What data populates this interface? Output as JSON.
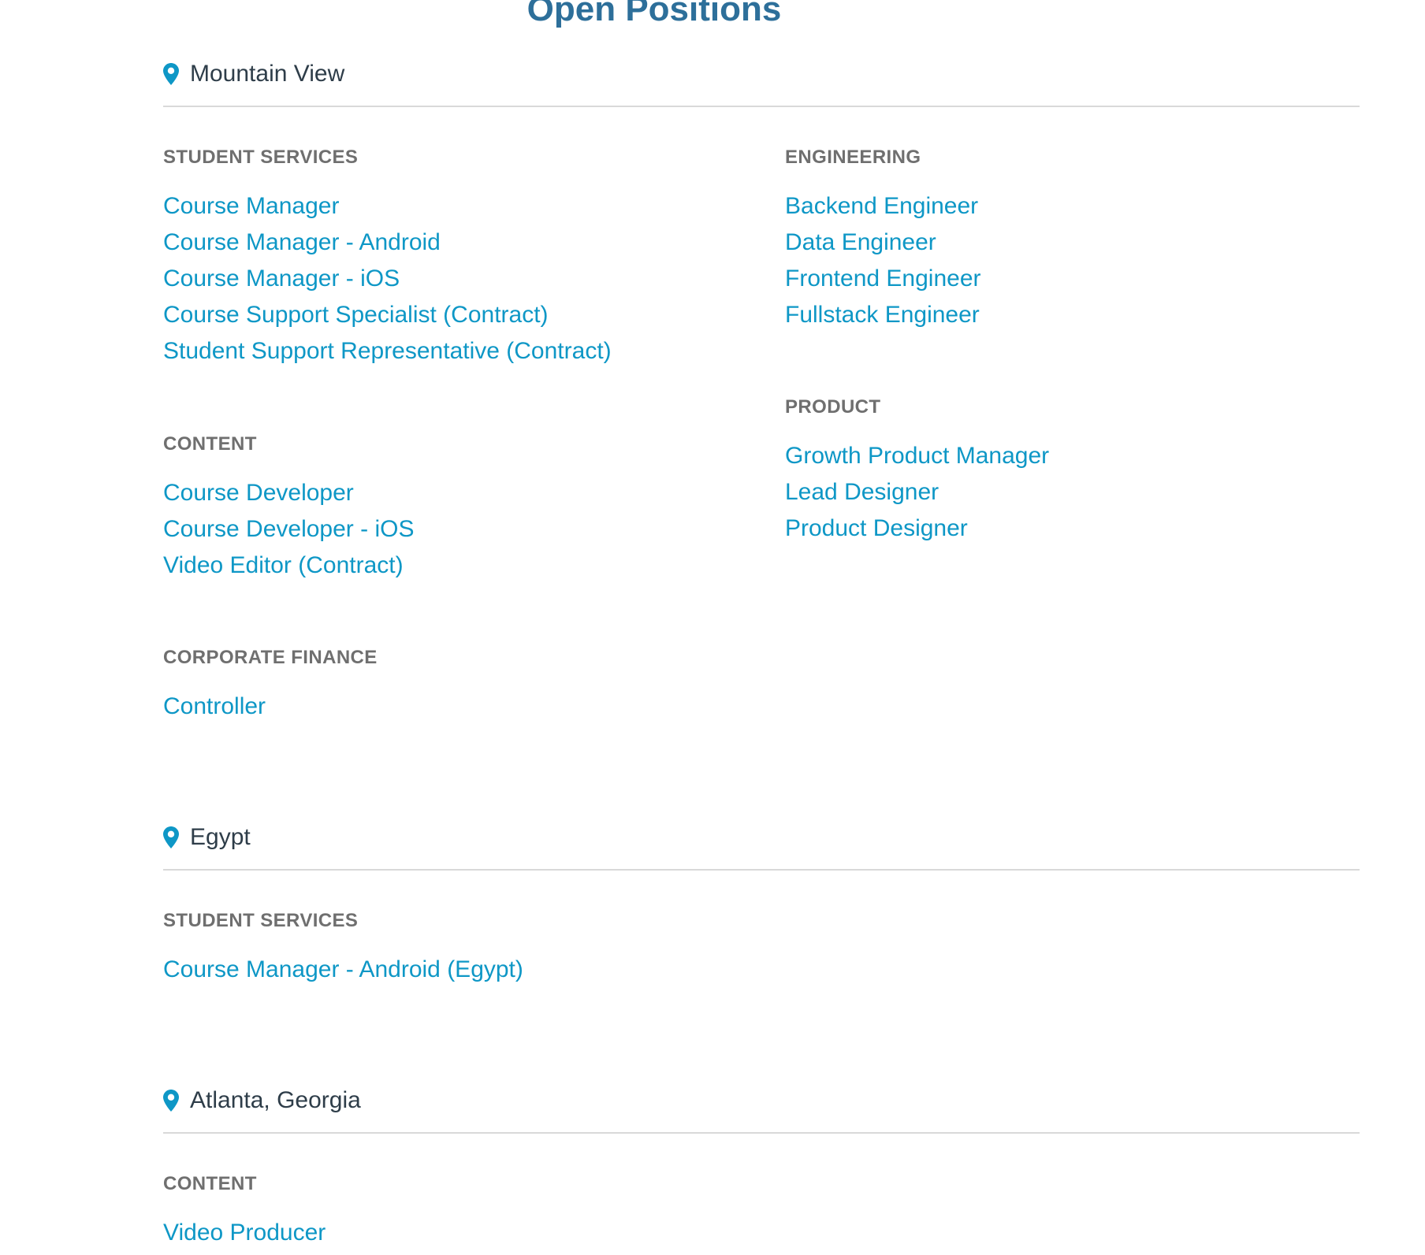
{
  "page": {
    "title": "Open Positions"
  },
  "colors": {
    "accent": "#0e97c6",
    "title": "#2d6f9a",
    "heading_gray": "#6f6f6f",
    "text_dark": "#2e3d49",
    "divider": "#d9d9d9"
  },
  "locations": [
    {
      "name": "Mountain View",
      "icon": "map-pin-icon",
      "departments": [
        {
          "title": "STUDENT SERVICES",
          "jobs": [
            "Course Manager",
            "Course Manager - Android",
            "Course Manager - iOS",
            "Course Support Specialist (Contract)",
            "Student Support Representative (Contract)"
          ]
        },
        {
          "title": "CONTENT",
          "jobs": [
            "Course Developer",
            "Course Developer - iOS",
            "Video Editor (Contract)"
          ]
        },
        {
          "title": "CORPORATE FINANCE",
          "jobs": [
            "Controller"
          ]
        },
        {
          "title": "ENGINEERING",
          "jobs": [
            "Backend Engineer",
            "Data Engineer",
            "Frontend Engineer",
            "Fullstack Engineer"
          ]
        },
        {
          "title": "PRODUCT",
          "jobs": [
            "Growth Product Manager",
            "Lead Designer",
            "Product Designer"
          ]
        }
      ]
    },
    {
      "name": "Egypt",
      "icon": "map-pin-icon",
      "departments": [
        {
          "title": "STUDENT SERVICES",
          "jobs": [
            "Course Manager - Android (Egypt)"
          ]
        }
      ]
    },
    {
      "name": "Atlanta, Georgia",
      "icon": "map-pin-icon",
      "departments": [
        {
          "title": "CONTENT",
          "jobs": [
            "Video Producer"
          ]
        }
      ]
    }
  ]
}
